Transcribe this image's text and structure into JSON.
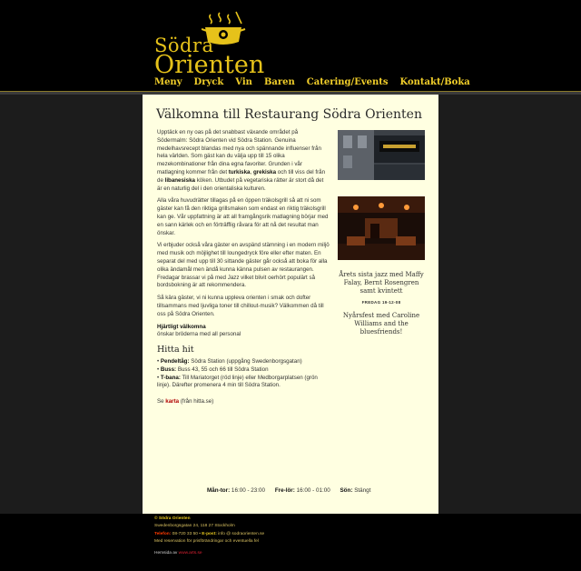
{
  "logo": {
    "word1": "Södra",
    "word2": "Orienten"
  },
  "nav": [
    "Meny",
    "Dryck",
    "Vin",
    "Baren",
    "Catering/Events",
    "Kontakt/Boka"
  ],
  "main": {
    "title": "Välkomna till Restaurang Södra Orienten",
    "p1_a": "Upptäck en ny oas på det snabbast växande området på Södermalm: Södra Orienten vid Södra Station. Genuina medelhavsrecept blandas med nya och spännande influenser från hela världen. Som gäst kan du välja upp till 15 olika mezekombinationer från dina egna favoriter. Grunden i vår matlagning kommer från det ",
    "p1_b1": "turkiska",
    "p1_sep1": ", ",
    "p1_b2": "grekiska",
    "p1_mid": " och till viss del från de ",
    "p1_b3": "libanesiska",
    "p1_end": " köken. Utbudet på vegetariska rätter är stort då det är en naturlig del i den orientaliska kulturen.",
    "p2": "Alla våra huvudrätter tillagas på en öppen träkolsgrill så att ni som gäster kan få den riktiga grillsmaken som endast en riktig träkolsgrill kan ge. Vår uppfattning är att all framgångsrik matlagning börjar med en sann kärlek och en förträfflig råvara för att nå det resultat man önskar.",
    "p3": "Vi erbjuder också våra gäster en avspänd stämning i en modern miljö med musik och möjlighet till loungedryck före eller efter maten. En separat del med upp till 30 sittande gäster går också att boka för alla olika ändamål men ändå kunna känna pulsen av restaurangen. Fredagar brassar vi på med Jazz vilket blivit oerhört populärt så bordsbokning är att rekommendera.",
    "p4": "Så kära gäster, vi ni kunna uppleva orienten i smak och dofter tillsammans med ljuvliga toner till chillout-musik? Välkommen då till oss på Södra Orienten.",
    "greeting": "Hjärtligt välkomna",
    "greeting_sub": "önskar bröderna med all personal",
    "hitta_title": "Hitta hit",
    "dir1_label": "Pendeltåg:",
    "dir1_text": " Södra Station (uppgång Swedenborgsgatan)",
    "dir2_label": "Buss:",
    "dir2_text": " Buss 43, 55 och 66 till Södra Station",
    "dir3_label": "T-bana:",
    "dir3_text": " Till Mariatorget (röd linje) eller Medborgarplatsen (grön linje). Därefter promenera 4 min till Södra Station.",
    "map_pre": "Se ",
    "map_link": "karta",
    "map_post": " (från hitta.se)"
  },
  "sidebar": {
    "event1": "Årets sista jazz med Maffy Falay, Bernt Rosengren samt kvintett",
    "event1_date": "FREDAG 19-12-08",
    "event2": "Nyårsfest med Caroline Williams and the bluesfriends!"
  },
  "hours": {
    "h1_label": "Mån-tor:",
    "h1_value": " 16:00 - 23:00",
    "h2_label": "Fre-lör:",
    "h2_value": " 16:00 - 01:00",
    "h3_label": "Sön:",
    "h3_value": " Stängt"
  },
  "footer": {
    "name": "© Södra Orienten",
    "address": "Swedenborgsgatan 24, 118 27 Stockholm",
    "phone_label": "Telefon:",
    "phone": " 08-720 33 50 • ",
    "email_label": "E-post:",
    "email": " info @ sodraorienten.se",
    "note": "Med reservation för prisförändringar och eventuella fel",
    "credit_pre": "Hemsida av ",
    "credit_link": "www.arts.se"
  },
  "colors": {
    "gold": "#e6c21a",
    "cream": "#ffffe1",
    "red": "#b00000"
  }
}
